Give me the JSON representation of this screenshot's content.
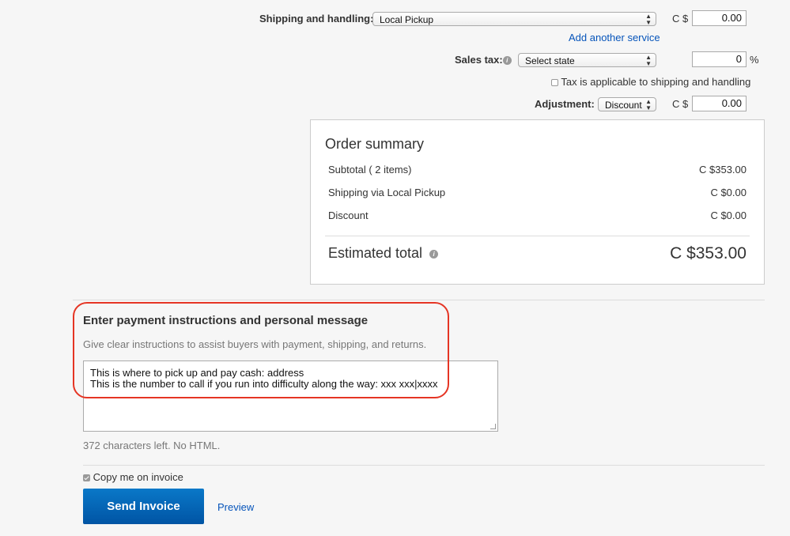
{
  "shipping": {
    "label": "Shipping and handling:",
    "service_selected": "Local Pickup",
    "currency": "C $",
    "amount": "0.00",
    "add_service_link": "Add another service"
  },
  "sales_tax": {
    "label": "Sales tax:",
    "info_icon": "info-icon",
    "state_selected": "Select state",
    "rate": "0",
    "percent_sign": "%",
    "apply_to_shipping_label": "Tax is applicable to shipping and handling",
    "apply_to_shipping_checked": false
  },
  "adjustment": {
    "label": "Adjustment:",
    "type_selected": "Discount",
    "currency": "C $",
    "amount": "0.00"
  },
  "order_summary": {
    "title": "Order summary",
    "rows": [
      {
        "label": "Subtotal ( 2 items)",
        "value": "C $353.00"
      },
      {
        "label": "Shipping via Local Pickup",
        "value": "C $0.00"
      },
      {
        "label": "Discount",
        "value": "C $0.00"
      }
    ],
    "total_label": "Estimated total",
    "total_value": "C $353.00"
  },
  "message": {
    "heading": "Enter payment instructions and personal message",
    "helper": "Give clear instructions to assist buyers with payment, shipping, and returns.",
    "value": "This is where to pick up and pay cash: address\nThis is the number to call if you run into difficulty along the way: xxx xxx|xxxx",
    "chars_left": "372 characters left. No HTML."
  },
  "copy_me": {
    "label": "Copy me on invoice",
    "checked": true
  },
  "actions": {
    "send_label": "Send Invoice",
    "preview_label": "Preview"
  },
  "colors": {
    "link": "#0654ba",
    "button": "#0a6bbd",
    "highlight": "#e53524"
  }
}
